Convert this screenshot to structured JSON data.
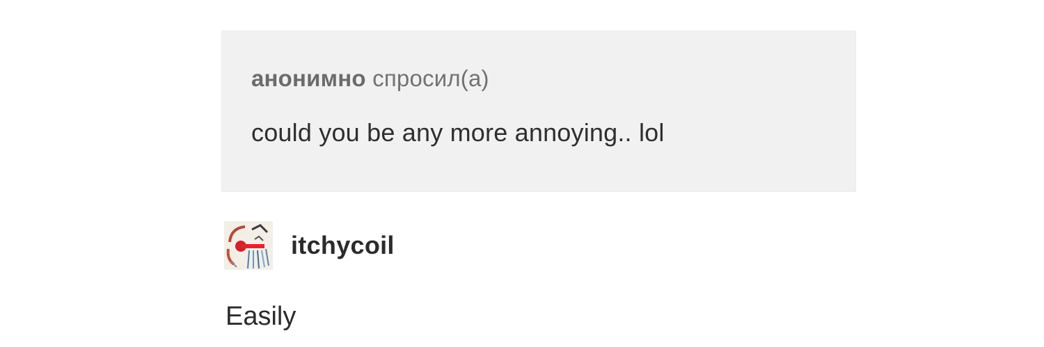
{
  "ask": {
    "asker": "анонимно",
    "verb": "спросил(а)",
    "question": "could you be any more annoying.. lol"
  },
  "answer": {
    "username": "itchycoil",
    "avatar_icon": "user-avatar-abstract-art",
    "text": "Easily"
  },
  "colors": {
    "ask_background": "#f1f1f1",
    "page_background": "#ffffff",
    "meta_text": "#6b6b6b",
    "body_text": "#2b2b2b"
  }
}
